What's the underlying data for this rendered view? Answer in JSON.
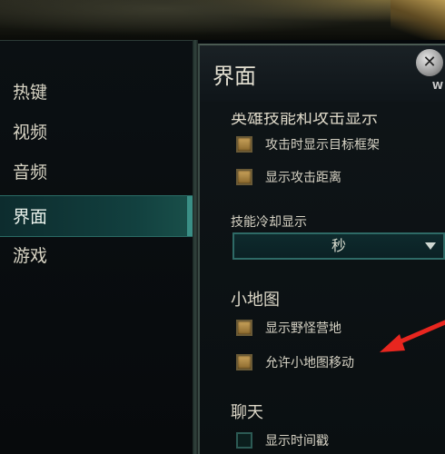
{
  "sidebar": {
    "items": [
      {
        "label": "热键",
        "active": false
      },
      {
        "label": "视频",
        "active": false
      },
      {
        "label": "音频",
        "active": false
      },
      {
        "label": "界面",
        "active": true
      },
      {
        "label": "游戏",
        "active": false
      }
    ]
  },
  "panel": {
    "title": "界面",
    "close_subtext": "W",
    "sections": {
      "hero_skills": {
        "title": "英雄技能和攻击显示",
        "options": [
          {
            "label": "攻击时显示目标框架",
            "checked": true
          },
          {
            "label": "显示攻击距离",
            "checked": true
          }
        ],
        "cooldown_label": "技能冷却显示",
        "cooldown_value": "秒"
      },
      "minimap": {
        "title": "小地图",
        "options": [
          {
            "label": "显示野怪营地",
            "checked": true
          },
          {
            "label": "允许小地图移动",
            "checked": true
          }
        ]
      },
      "chat": {
        "title": "聊天",
        "options": [
          {
            "label": "显示时间戳",
            "checked": false
          }
        ]
      }
    }
  },
  "colors": {
    "accent_teal": "#2e6a66",
    "checkbox_gold": "#c9a25a",
    "annotation_red": "#e8261f"
  },
  "icons": {
    "close": "close-icon",
    "dropdown": "chevron-down-icon",
    "annotation": "red-arrow-annotation"
  }
}
